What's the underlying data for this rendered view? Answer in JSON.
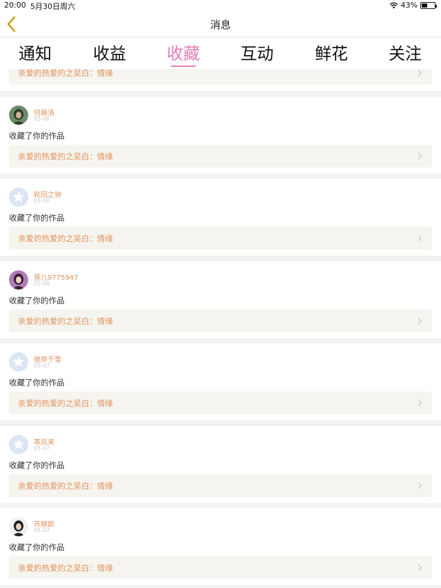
{
  "status_bar": {
    "time": "20:00",
    "date": "5月30日周六",
    "battery": "43%",
    "battery_level": 0.43
  },
  "nav": {
    "title": "消息",
    "back_icon": "chevron-left-icon",
    "accent": "#c7a020"
  },
  "tabs": [
    {
      "label": "通知"
    },
    {
      "label": "收益"
    },
    {
      "label": "收藏"
    },
    {
      "label": "互动"
    },
    {
      "label": "鲜花"
    },
    {
      "label": "关注"
    }
  ],
  "active_tab": 2,
  "accent_color": "#e57cb6",
  "list": {
    "partial_item": {
      "work_title": "亲爱的热爱的之吴白：情缘"
    },
    "items": [
      {
        "name": "何晨洛",
        "date": "05-08",
        "action": "收藏了你的作品",
        "work_title": "亲爱的热爱的之吴白：情缘",
        "avatar": "photo-avatar"
      },
      {
        "name": "轮回之钟",
        "date": "05-08",
        "action": "收藏了你的作品",
        "work_title": "亲爱的热爱的之吴白：情缘",
        "avatar": "default-star-avatar"
      },
      {
        "name": "萱儿9775947",
        "date": "05-08",
        "action": "收藏了你的作品",
        "work_title": "亲爱的热爱的之吴白：情缘",
        "avatar": "photo-avatar"
      },
      {
        "name": "彼岸千雪",
        "date": "05-07",
        "action": "收藏了你的作品",
        "work_title": "亲爱的热爱的之吴白：情缘",
        "avatar": "default-star-avatar"
      },
      {
        "name": "等风来",
        "date": "05-07",
        "action": "收藏了你的作品",
        "work_title": "亲爱的热爱的之吴白：情缘",
        "avatar": "default-star-avatar"
      },
      {
        "name": "苏穆颜",
        "date": "05-07",
        "action": "收藏了你的作品",
        "work_title": "亲爱的热爱的之吴白：情缘",
        "avatar": "photo-avatar"
      }
    ]
  }
}
